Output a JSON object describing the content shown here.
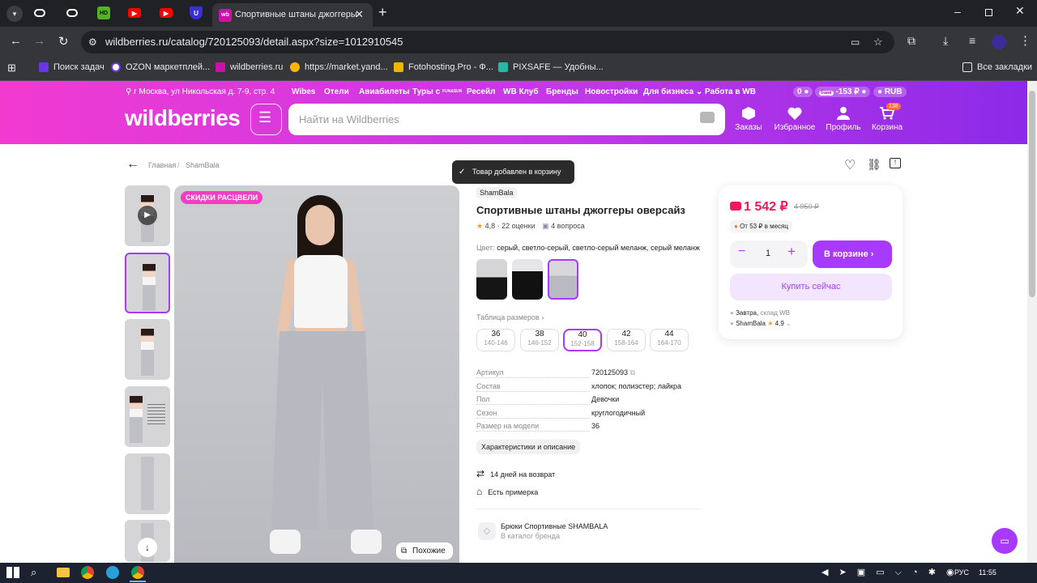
{
  "browser": {
    "active_tab": {
      "title": "Спортивные штаны джоггеры"
    },
    "url": "wildberries.ru/catalog/720125093/detail.aspx?size=1012910545",
    "bookmarks": [
      "Поиск задач",
      "OZON маркетплей...",
      "wildberries.ru",
      "https://market.yand...",
      "Fotohosting.Pro - Ф...",
      "PIXSAFE — Удобны..."
    ],
    "all_bookmarks": "Все закладки"
  },
  "header": {
    "location": "г Москва, ул Никольская д. 7-9, стр. 4",
    "links": [
      "Wibes",
      "Отели",
      "Авиабилеты",
      "Туры с",
      "Ресейл",
      "WB Клуб",
      "Бренды",
      "Новостройки",
      "Для бизнеса",
      "Работа в WB"
    ],
    "tours_badge": "FUN&SUN",
    "balance": "0",
    "bank": "банк",
    "bank_balance": "-153 ₽",
    "currency": "RUB",
    "logo": "wildberries",
    "search_placeholder": "Найти на Wildberries",
    "nav": {
      "orders": "Заказы",
      "favorites": "Избранное",
      "profile": "Профиль",
      "cart": "Корзина",
      "cart_count": "138"
    },
    "brand_color": "#cb11ab"
  },
  "breadcrumb": {
    "home": "Главная",
    "brand": "ShamBala"
  },
  "toast": "Товар добавлен в корзину",
  "gallery": {
    "badge": "СКИДКИ РАСЦВЕЛИ",
    "similar": "Похожие"
  },
  "product": {
    "brand": "ShamBala",
    "title": "Спортивные штаны джоггеры оверсайз",
    "rating": "4,8",
    "reviews": "22 оценки",
    "questions": "4 вопроса",
    "color_label": "Цвет:",
    "color_value": "серый, светло-серый, светло-серый меланж, серый меланж",
    "size_table": "Таблица размеров",
    "sizes": [
      {
        "size": "36",
        "range": "140-146"
      },
      {
        "size": "38",
        "range": "146-152"
      },
      {
        "size": "40",
        "range": "152-158"
      },
      {
        "size": "42",
        "range": "158-164"
      },
      {
        "size": "44",
        "range": "164-170"
      }
    ],
    "specs": [
      {
        "label": "Артикул",
        "value": "720125093"
      },
      {
        "label": "Состав",
        "value": "хлопок; полиэстер; лайкра"
      },
      {
        "label": "Пол",
        "value": "Девочки"
      },
      {
        "label": "Сезон",
        "value": "круглогодичный"
      },
      {
        "label": "Размер на модели",
        "value": "36"
      }
    ],
    "specs_button": "Характеристики и описание",
    "returns": "14 дней на возврат",
    "fitting": "Есть примерка",
    "catalog_title": "Брюки Спортивные SHAMBALA",
    "catalog_link": "В каталог бренда"
  },
  "buybox": {
    "price": "1 542 ₽",
    "old_price": "4 950 ₽",
    "installment": "От 53 ₽ в месяц",
    "qty": "1",
    "in_cart": "В корзине",
    "buy_now": "Купить сейчас",
    "delivery": "Завтра",
    "warehouse": "склад WB",
    "seller": "ShamBala",
    "seller_rating": "4,9"
  },
  "taskbar": {
    "lang": "РУС",
    "time": "11:55"
  }
}
